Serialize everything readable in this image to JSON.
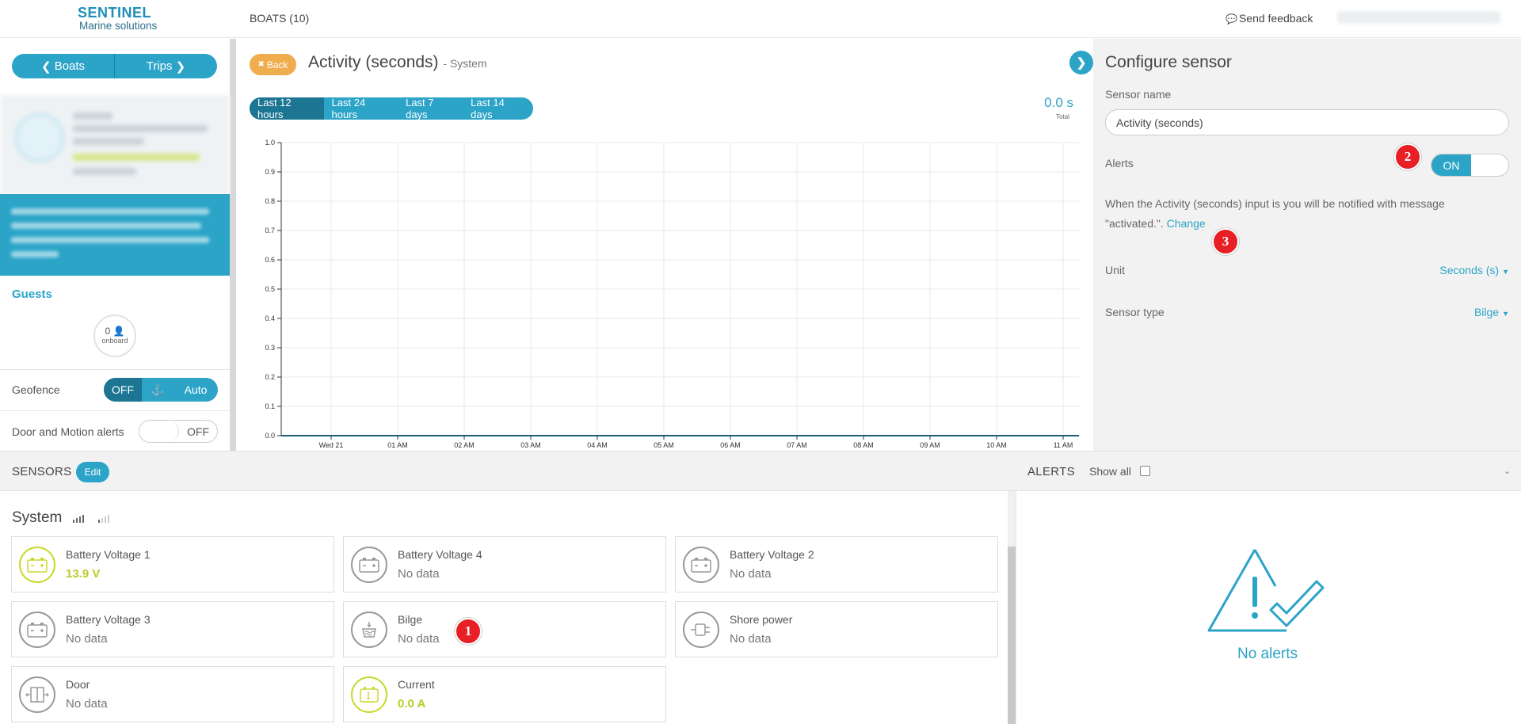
{
  "header": {
    "brand": "SENTINEL",
    "brand_sub": "Marine solutions",
    "nav_boats": "BOATS (10)",
    "feedback": "Send feedback"
  },
  "sidebar": {
    "boats_btn": "Boats",
    "trips_btn": "Trips",
    "guests_title": "Guests",
    "guests_count": "0",
    "guests_onboard": "onboard",
    "geofence_label": "Geofence",
    "geofence_off": "OFF",
    "geofence_auto": "Auto",
    "door_label": "Door and Motion alerts",
    "door_state": "OFF"
  },
  "center": {
    "back_btn": "Back",
    "title": "Activity (seconds)",
    "subtitle": "- System",
    "ranges": [
      "Last 12 hours",
      "Last 24 hours",
      "Last 7 days",
      "Last 14 days"
    ],
    "active_range": 0,
    "total_value": "0.0 s",
    "total_label": "Total"
  },
  "chart_data": {
    "type": "line",
    "title": "",
    "xlabel": "",
    "ylabel": "",
    "x_ticks": [
      "Wed 21",
      "01 AM",
      "02 AM",
      "03 AM",
      "04 AM",
      "05 AM",
      "06 AM",
      "07 AM",
      "08 AM",
      "09 AM",
      "10 AM",
      "11 AM"
    ],
    "y_ticks": [
      "0.0",
      "0.1",
      "0.2",
      "0.3",
      "0.4",
      "0.5",
      "0.6",
      "0.7",
      "0.8",
      "0.9",
      "1.0"
    ],
    "ylim": [
      0,
      1
    ],
    "grid": true,
    "series": [
      {
        "values": [
          0,
          0,
          0,
          0,
          0,
          0,
          0,
          0,
          0,
          0,
          0,
          0
        ]
      }
    ]
  },
  "config": {
    "title": "Configure sensor",
    "sensor_name_label": "Sensor name",
    "sensor_name_value": "Activity (seconds)",
    "alerts_label": "Alerts",
    "alerts_state": "ON",
    "alert_message": "When the Activity (seconds) input is you will be notified with message \"activated.\".",
    "change_link": "Change",
    "unit_label": "Unit",
    "unit_value": "Seconds (s)",
    "type_label": "Sensor type",
    "type_value": "Bilge"
  },
  "markers": [
    "1",
    "2",
    "3"
  ],
  "sensors": {
    "title": "SENSORS",
    "edit_btn": "Edit",
    "group_title": "System",
    "cards": [
      {
        "name": "Battery Voltage 1",
        "value": "13.9 V",
        "icon": "battery-icon",
        "active": true
      },
      {
        "name": "Battery Voltage 4",
        "value": "No data",
        "icon": "battery-icon",
        "active": false
      },
      {
        "name": "Battery Voltage 2",
        "value": "No data",
        "icon": "battery-icon",
        "active": false
      },
      {
        "name": "Battery Voltage 3",
        "value": "No data",
        "icon": "battery-icon",
        "active": false
      },
      {
        "name": "Bilge",
        "value": "No data",
        "icon": "bilge-icon",
        "active": false
      },
      {
        "name": "Shore power",
        "value": "No data",
        "icon": "plug-icon",
        "active": false
      },
      {
        "name": "Door",
        "value": "No data",
        "icon": "door-icon",
        "active": false
      },
      {
        "name": "Current",
        "value": "0.0 A",
        "icon": "current-icon",
        "active": true
      }
    ]
  },
  "alerts": {
    "title": "ALERTS",
    "show_all": "Show all",
    "empty_text": "No alerts"
  },
  "colors": {
    "accent": "#2ba4c8",
    "accent_dark": "#1b7593",
    "back_button": "#f0ad4e",
    "marker": "#e81f24",
    "active_sensor": "#c8d92c"
  }
}
